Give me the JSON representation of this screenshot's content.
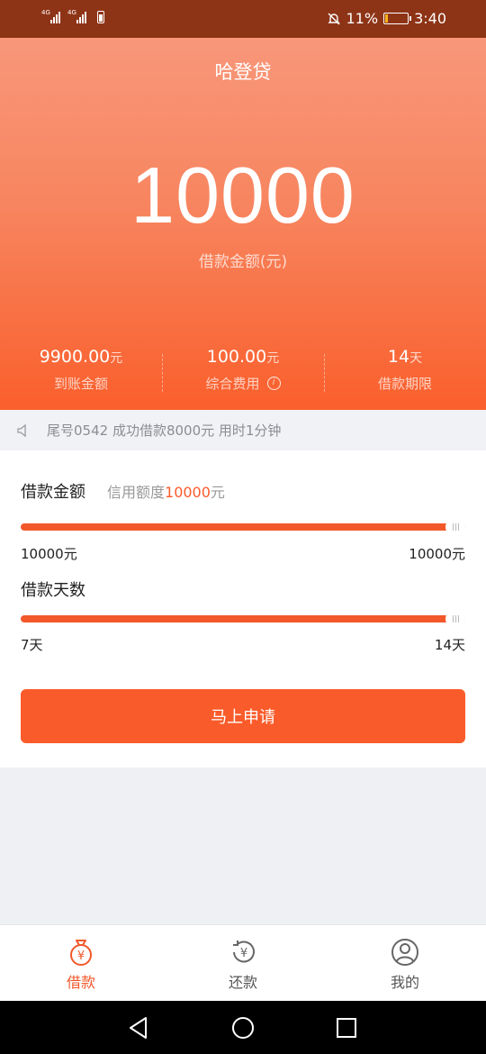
{
  "status_bar": {
    "signal1_label": "4G",
    "signal2_label": "4G",
    "battery_percent": "11%",
    "battery_level": 0.11,
    "time": "3:40",
    "icons": [
      "signal-icon",
      "signal-icon",
      "battery-icon",
      "mute-bell-icon",
      "battery-icon"
    ]
  },
  "hero": {
    "app_title": "哈登贷",
    "amount": "10000",
    "amount_label": "借款金额(元)",
    "stats": [
      {
        "value": "9900.00",
        "unit": "元",
        "label": "到账金额"
      },
      {
        "value": "100.00",
        "unit": "元",
        "label": "综合费用"
      },
      {
        "value": "14",
        "unit": "天",
        "label": "借款期限"
      }
    ],
    "info_icon": "i"
  },
  "notice": {
    "text": "尾号0542 成功借款8000元 用时1分钟",
    "icon": "speaker-icon"
  },
  "loan_amount": {
    "heading": "借款金额",
    "credit_prefix": "信用额度",
    "credit_value": "10000",
    "credit_unit": "元",
    "slider_value": 1.0,
    "min_label": "10000元",
    "max_label": "10000元"
  },
  "loan_days": {
    "heading": "借款天数",
    "slider_value": 1.0,
    "min_label": "7天",
    "max_label": "14天"
  },
  "apply_button": "马上申请",
  "tabs": [
    {
      "label": "借款",
      "icon": "money-bag-icon",
      "active": true
    },
    {
      "label": "还款",
      "icon": "repay-icon",
      "active": false
    },
    {
      "label": "我的",
      "icon": "user-icon",
      "active": false
    }
  ],
  "colors": {
    "accent": "#fa5b2a",
    "status_bar": "#8e3416"
  }
}
